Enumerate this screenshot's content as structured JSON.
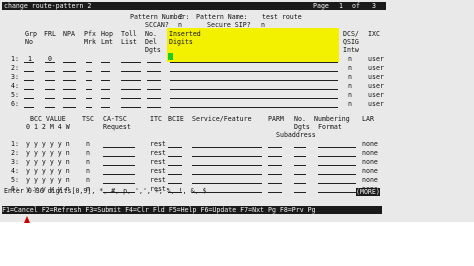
{
  "header": {
    "command": "change route-pattern 2",
    "page_label": "Page",
    "page_current": "1",
    "page_of": "of",
    "page_total": "3",
    "pattern_number_label": "Pattern Number:",
    "pattern_number": "2",
    "pattern_name_label": "Pattern Name:",
    "pattern_name": "test route",
    "scca_label": "SCCAN?",
    "scca_value": "n",
    "secure_sip_label": "Secure SIP?",
    "secure_sip_value": "n"
  },
  "trunk_table": {
    "headers": {
      "grp": "Grp",
      "no": "No",
      "frl": "FRL",
      "npa": "NPA",
      "pfx": "Pfx",
      "mrk": "Mrk",
      "hop": "Hop",
      "lmt": "Lmt",
      "toll": "Toll",
      "list": "List",
      "no2": "No.",
      "del": "Del",
      "dgts": "Dgts",
      "inserted": "Inserted",
      "digits": "Digits",
      "dcs": "DCS/",
      "qsig": "QSIG",
      "intw": "Intw",
      "ixc": "IXC"
    },
    "rows": [
      {
        "idx": "1:",
        "grp": "1",
        "frl": "0",
        "intw": "n",
        "ixc": "user"
      },
      {
        "idx": "2:",
        "grp": "",
        "frl": "",
        "intw": "n",
        "ixc": "user"
      },
      {
        "idx": "3:",
        "grp": "",
        "frl": "",
        "intw": "n",
        "ixc": "user"
      },
      {
        "idx": "4:",
        "grp": "",
        "frl": "",
        "intw": "n",
        "ixc": "user"
      },
      {
        "idx": "5:",
        "grp": "",
        "frl": "",
        "intw": "n",
        "ixc": "user"
      },
      {
        "idx": "6:",
        "grp": "",
        "frl": "",
        "intw": "n",
        "ixc": "user"
      }
    ]
  },
  "bcc_table": {
    "headers": {
      "bcc_value": "BCC VALUE",
      "tsc": "TSC",
      "ca_tsc": "CA-TSC",
      "request": "Request",
      "itc": "ITC",
      "bcie": "BCIE",
      "service": "Service/Feature",
      "parm": "PARM",
      "no_dgts": "No.",
      "dgts": "Dgts",
      "numbering": "Numbering",
      "format": "Format",
      "subaddress": "Subaddress",
      "lar": "LAR",
      "cols": "0 1 2 M 4 W"
    },
    "rows": [
      {
        "idx": "1:",
        "bcc": "y y y y y n",
        "tsc": "n",
        "itc": "rest",
        "lar": "none"
      },
      {
        "idx": "2:",
        "bcc": "y y y y y n",
        "tsc": "n",
        "itc": "rest",
        "lar": "none"
      },
      {
        "idx": "3:",
        "bcc": "y y y y y n",
        "tsc": "n",
        "itc": "rest",
        "lar": "none"
      },
      {
        "idx": "4:",
        "bcc": "y y y y y n",
        "tsc": "n",
        "itc": "rest",
        "lar": "none"
      },
      {
        "idx": "5:",
        "bcc": "y y y y y n",
        "tsc": "n",
        "itc": "rest",
        "lar": "none"
      },
      {
        "idx": "6:",
        "bcc": "y y y y y n",
        "tsc": "n",
        "itc": "rest",
        "lar": "none"
      }
    ]
  },
  "status": {
    "hint": "Enter 0-36 digits[0,9], *, #, p, ',', +, %, !, &, $",
    "more": "(MORE)"
  },
  "function_keys": "F1=Cancel F2=Refresh F3=Submit F4=Clr Fld F5=Help F6=Update F7=Nxt Pg F8=Prv Pg",
  "colors": {
    "highlight": "#f3f000",
    "cursor": "#1dcd1d",
    "bar": "#1a1a1a"
  }
}
